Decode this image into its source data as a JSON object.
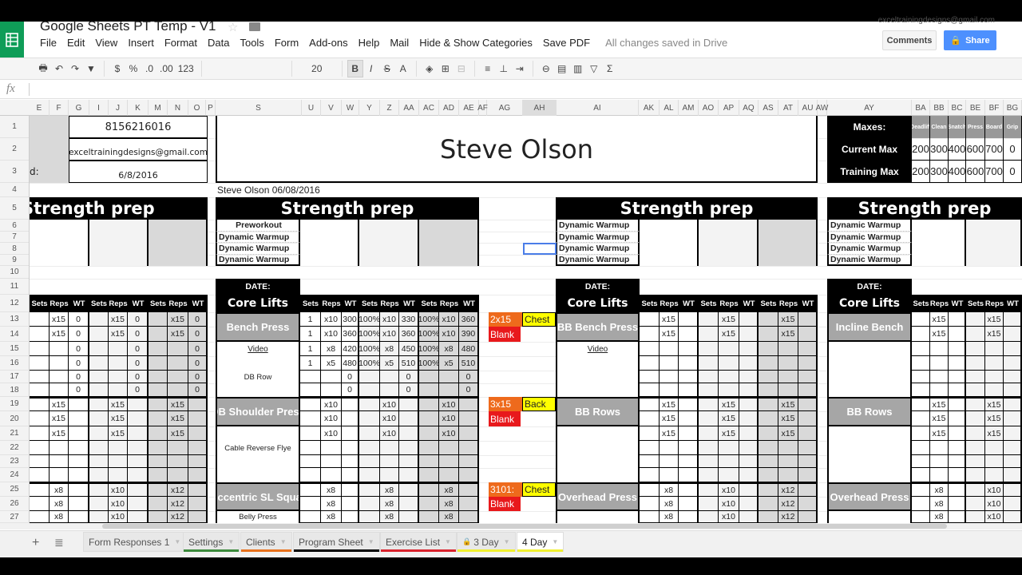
{
  "app": {
    "title": "Google Sheets PT Temp - V1",
    "account": "exceltrainingdesigns@gmail.com",
    "saved_status": "All changes saved in Drive",
    "comments_label": "Comments",
    "share_label": "Share"
  },
  "menu": [
    "File",
    "Edit",
    "View",
    "Insert",
    "Format",
    "Data",
    "Tools",
    "Form",
    "Add-ons",
    "Help",
    "Mail",
    "Hide & Show Categories",
    "Save PDF"
  ],
  "toolbar": {
    "number_format": "123",
    "font_size": "20",
    "currency": "$",
    "percent": "%",
    "dec_less": ".0",
    "dec_more": ".00"
  },
  "formula_bar": {
    "fx_label": "fx",
    "value": ""
  },
  "columns": [
    "E",
    "F",
    "G",
    "I",
    "J",
    "K",
    "M",
    "N",
    "O",
    "P",
    "S",
    "U",
    "V",
    "W",
    "Y",
    "Z",
    "AA",
    "AC",
    "AD",
    "AE",
    "AF",
    "AG",
    "AH",
    "AI",
    "AK",
    "AL",
    "AM",
    "AO",
    "AP",
    "AQ",
    "AS",
    "AT",
    "AU",
    "AW",
    "AY",
    "BA",
    "BB",
    "BC",
    "BE",
    "BF",
    "BG"
  ],
  "rows": [
    "1",
    "2",
    "3",
    "4",
    "5",
    "6",
    "7",
    "8",
    "9",
    "10",
    "11",
    "12",
    "13",
    "14",
    "15",
    "16",
    "17",
    "18",
    "19",
    "20",
    "21",
    "22",
    "23",
    "24",
    "25",
    "26",
    "27"
  ],
  "header": {
    "phone": "8156216016",
    "email": "exceltrainingdesigns@gmail.com",
    "date_label": "d:",
    "date": "6/8/2016",
    "client_name": "Steve Olson",
    "subtitle": "Steve Olson 06/08/2016"
  },
  "maxes": {
    "label": "Maxes:",
    "current_label": "Current Max",
    "training_label": "Training Max",
    "lifts": [
      "Deadlift",
      "Clean",
      "Snatch",
      "Press",
      "Board",
      "Grip"
    ],
    "current": [
      "200",
      "300",
      "400",
      "600",
      "700",
      "0"
    ],
    "training": [
      "200",
      "300",
      "400",
      "600",
      "700",
      "0"
    ]
  },
  "section_title": "Strength prep",
  "preworkout": [
    "Preworkout",
    "Dynamic Warmup",
    "Dynamic Warmup",
    "Dynamic Warmup"
  ],
  "dynamic": [
    "Dynamic Warmup",
    "Dynamic Warmup",
    "Dynamic Warmup",
    "Dynamic Warmup"
  ],
  "date_label": "DATE:",
  "core_lifts_label": "Core Lifts",
  "set_headers": [
    "Sets",
    "Reps",
    "WT"
  ],
  "left_block": {
    "r13": [
      "",
      "x15",
      "0",
      "",
      "x15",
      "0",
      "",
      "x15",
      "0"
    ],
    "r14": [
      "",
      "x15",
      "0",
      "",
      "x15",
      "0",
      "",
      "x15",
      "0"
    ],
    "r15": [
      "",
      "",
      "0",
      "",
      "",
      "0",
      "",
      "",
      "0"
    ],
    "r16": [
      "",
      "",
      "0",
      "",
      "",
      "0",
      "",
      "",
      "0"
    ],
    "r17": [
      "",
      "",
      "0",
      "",
      "",
      "0",
      "",
      "",
      "0"
    ],
    "r18": [
      "",
      "",
      "0",
      "",
      "",
      "0",
      "",
      "",
      "0"
    ],
    "r19": [
      "",
      "x15",
      "",
      "",
      "x15",
      "",
      "",
      "x15",
      ""
    ],
    "r20": [
      "",
      "x15",
      "",
      "",
      "x15",
      "",
      "",
      "x15",
      ""
    ],
    "r21": [
      "",
      "x15",
      "",
      "",
      "x15",
      "",
      "",
      "x15",
      ""
    ],
    "r25": [
      "",
      "x8",
      "",
      "",
      "x10",
      "",
      "",
      "x12",
      ""
    ],
    "r26": [
      "",
      "x8",
      "",
      "",
      "x10",
      "",
      "",
      "x12",
      ""
    ],
    "r27": [
      "",
      "x8",
      "",
      "",
      "x10",
      "",
      "",
      "x12",
      ""
    ]
  },
  "day2": {
    "ex1": "Bench Press",
    "ex1_link": "Video",
    "ex1_sub": "DB Row",
    "ex2": "DB Shoulder Press",
    "ex2_sub": "Cable Reverse Flye",
    "ex3": "Eccentric SL Squat",
    "ex3_sub": "Belly Press",
    "r13": [
      "1",
      "x10",
      "300",
      "100%",
      "x10",
      "330",
      "100%",
      "x10",
      "360"
    ],
    "r14": [
      "1",
      "x10",
      "360",
      "100%",
      "x10",
      "360",
      "100%",
      "x10",
      "390"
    ],
    "r15": [
      "1",
      "x8",
      "420",
      "100%",
      "x8",
      "450",
      "100%",
      "x8",
      "480"
    ],
    "r16": [
      "1",
      "x5",
      "480",
      "100%",
      "x5",
      "510",
      "100%",
      "x5",
      "510"
    ],
    "r17": [
      "",
      "",
      "0",
      "",
      "",
      "0",
      "",
      "",
      "0"
    ],
    "r18": [
      "",
      "",
      "0",
      "",
      "",
      "0",
      "",
      "",
      "0"
    ],
    "r19": [
      "",
      "x10",
      "",
      "",
      "x10",
      "",
      "",
      "x10",
      ""
    ],
    "r20": [
      "",
      "x10",
      "",
      "",
      "x10",
      "",
      "",
      "x10",
      ""
    ],
    "r21": [
      "",
      "x10",
      "",
      "",
      "x10",
      "",
      "",
      "x10",
      ""
    ],
    "r25": [
      "",
      "x8",
      "",
      "",
      "x8",
      "",
      "",
      "x8",
      ""
    ],
    "r26": [
      "",
      "x8",
      "",
      "",
      "x8",
      "",
      "",
      "x8",
      ""
    ],
    "r27": [
      "",
      "x8",
      "",
      "",
      "x8",
      "",
      "",
      "x8",
      ""
    ]
  },
  "tags": [
    {
      "scheme": "2x15",
      "cat": "Chest",
      "blank": "Blank"
    },
    {
      "scheme": "3x15",
      "cat": "Back",
      "blank": "Blank"
    },
    {
      "scheme": "3101:",
      "cat": "Chest",
      "blank": "Blank"
    }
  ],
  "day3": {
    "ex1": "BB Bench Press",
    "ex1_link": "Video",
    "ex2": "BB Rows",
    "ex3": "Overhead Press",
    "r13": [
      "",
      "x15",
      "",
      "",
      "x15",
      "",
      "",
      "x15",
      ""
    ],
    "r14": [
      "",
      "x15",
      "",
      "",
      "x15",
      "",
      "",
      "x15",
      ""
    ],
    "r19": [
      "",
      "x15",
      "",
      "",
      "x15",
      "",
      "",
      "x15",
      ""
    ],
    "r20": [
      "",
      "x15",
      "",
      "",
      "x15",
      "",
      "",
      "x15",
      ""
    ],
    "r21": [
      "",
      "x15",
      "",
      "",
      "x15",
      "",
      "",
      "x15",
      ""
    ],
    "r25": [
      "",
      "x8",
      "",
      "",
      "x10",
      "",
      "",
      "x12",
      ""
    ],
    "r26": [
      "",
      "x8",
      "",
      "",
      "x10",
      "",
      "",
      "x12",
      ""
    ],
    "r27": [
      "",
      "x8",
      "",
      "",
      "x10",
      "",
      "",
      "x12",
      ""
    ]
  },
  "day4": {
    "ex1": "Incline Bench",
    "ex2": "BB Rows",
    "ex3": "Overhead Press",
    "r13": [
      "",
      "x15",
      "",
      "",
      "x15",
      ""
    ],
    "r14": [
      "",
      "x15",
      "",
      "",
      "x15",
      ""
    ],
    "r19": [
      "",
      "x15",
      "",
      "",
      "x15",
      ""
    ],
    "r20": [
      "",
      "x15",
      "",
      "",
      "x15",
      ""
    ],
    "r21": [
      "",
      "x15",
      "",
      "",
      "x15",
      ""
    ],
    "r25": [
      "",
      "x8",
      "",
      "",
      "x10",
      ""
    ],
    "r26": [
      "",
      "x8",
      "",
      "",
      "x10",
      ""
    ],
    "r27": [
      "",
      "x8",
      "",
      "",
      "x10",
      ""
    ]
  },
  "sheet_tabs": [
    {
      "label": "Form Responses 1",
      "color": ""
    },
    {
      "label": "Settings",
      "color": "#3c8a3c"
    },
    {
      "label": "Clients",
      "color": "#e8711c"
    },
    {
      "label": "Program Sheet",
      "color": "#000000"
    },
    {
      "label": "Exercise List",
      "color": "#d9232d"
    },
    {
      "label": "3 Day",
      "color": "#f0f030",
      "locked": true
    },
    {
      "label": "4 Day",
      "color": "#f0f030",
      "active": true
    }
  ]
}
